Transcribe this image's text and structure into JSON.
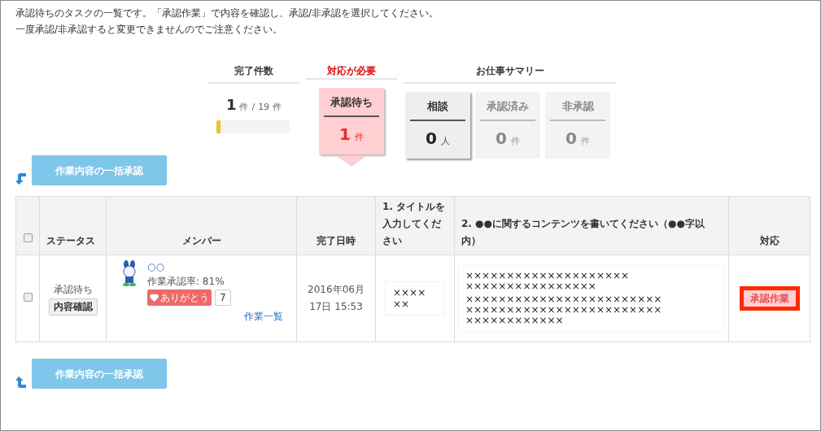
{
  "intro": [
    "承認待ちのタスクの一覧です。「承認作業」で内容を確認し、承認/非承認を選択してください。",
    "一度承認/非承認すると変更できませんのでご注意ください。"
  ],
  "summary": {
    "completed": {
      "heading": "完了件数",
      "count": "1",
      "unit": "件",
      "separator": "/",
      "total": "19",
      "total_unit": "件",
      "level": 0.05
    },
    "required": {
      "heading": "対応が必要",
      "card": {
        "label": "承認待ち",
        "count": "1",
        "unit": "件",
        "kind": "alert"
      }
    },
    "work": {
      "heading": "お仕事サマリー",
      "cards": [
        {
          "label": "相談",
          "count": "0",
          "unit": "人",
          "kind": "active"
        },
        {
          "label": "承認済み",
          "count": "0",
          "unit": "件",
          "kind": "muted"
        },
        {
          "label": "非承認",
          "count": "0",
          "unit": "件",
          "kind": "muted"
        }
      ]
    }
  },
  "bulk_button_top": "作業内容の一括承認",
  "table": {
    "columns": [
      "ステータス",
      "メンバー",
      "完了日時",
      "1. タイトルを入力してください",
      "2. ●●に関するコンテンツを書いてください（●●字以内）",
      "対応"
    ],
    "rows": [
      {
        "checked": false,
        "status": "承認待ち",
        "detail_button": "内容確認",
        "member_name": "○○",
        "approval_rate": "作業承認率: 81%",
        "thanks_label": "ありがとう",
        "thanks_count": "7",
        "task_list_link": "作業一覧",
        "date": "2016年06月17日 15:53",
        "title_lines": [
          "××××",
          "××"
        ],
        "content_lines": [
          "××××××××××××××××××××",
          "××××××××××××××××",
          "××××××××××××××××××××××××",
          "××××××××××××××××××××××××",
          "××××××××××××"
        ],
        "action_button": "承認作業"
      }
    ]
  },
  "header_checked": false,
  "bulk_button_bottom": "作業内容の一括承認"
}
